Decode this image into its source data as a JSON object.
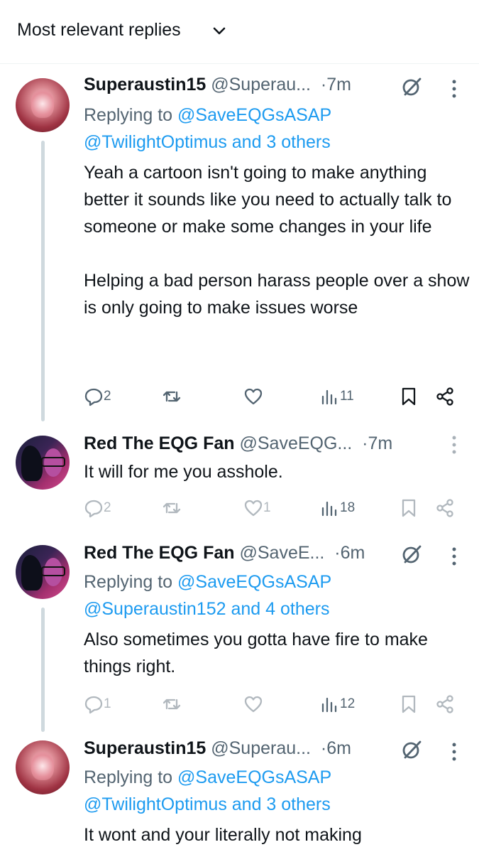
{
  "header": {
    "label": "Most relevant replies",
    "chevron_icon": "chevron-down-icon"
  },
  "tweets": [
    {
      "name": "Superaustin15",
      "handle": "@Superau...",
      "time": "7m",
      "reply_prefix": "Replying to ",
      "reply_mention": "@SaveEQGsASAP",
      "reply_line2": "@TwilightOptimus and 3 others",
      "text": "Yeah a cartoon isn't going to make anything better it sounds like you need to actually talk to someone or make some changes in your life\n\nHelping a bad person harass people over a show is only going to make issues worse",
      "replies": "2",
      "retweets": "",
      "likes": "",
      "views": "11"
    },
    {
      "name": "Red The EQG Fan",
      "handle": "@SaveEQG...",
      "time": "7m",
      "text": "It will for me you asshole.",
      "replies": "2",
      "retweets": "",
      "likes": "1",
      "views": "18"
    },
    {
      "name": "Red The EQG Fan",
      "handle": "@SaveE...",
      "time": "6m",
      "reply_prefix": "Replying to ",
      "reply_mention": "@SaveEQGsASAP",
      "reply_line2": "@Superaustin152 and 4 others",
      "text": "Also sometimes you gotta have fire to make things right.",
      "replies": "1",
      "retweets": "",
      "likes": "",
      "views": "12"
    },
    {
      "name": "Superaustin15",
      "handle": "@Superau...",
      "time": "6m",
      "reply_prefix": "Replying to ",
      "reply_mention": "@SaveEQGsASAP",
      "reply_line2": "@TwilightOptimus and 3 others",
      "text": "It wont and your literally not making",
      "replies": "",
      "retweets": "",
      "likes": "",
      "views": ""
    }
  ],
  "colors": {
    "text": "#0f1419",
    "secondary": "#536471",
    "link": "#1d9bf0",
    "thread": "#cfd9de"
  }
}
